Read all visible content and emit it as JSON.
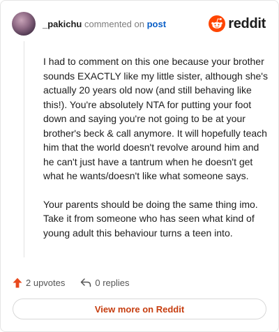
{
  "header": {
    "username": "_pakichu",
    "action_text": "commented on",
    "post_link": "post",
    "brand": "reddit"
  },
  "comment": {
    "paragraphs": [
      "I had to comment on this one because your brother sounds EXACTLY like my little sister, although she's actually 20 years old now (and still behaving like this!). You're absolutely NTA for putting your foot down and saying you're not going to be at your brother's beck & call anymore. It will hopefully teach him that the world doesn't revolve around him and he can't just have a tantrum when he doesn't get what he wants/doesn't like what someone says.",
      "Your parents should be doing the same thing imo. Take it from someone who has seen what kind of young adult this behaviour turns a teen into."
    ]
  },
  "actions": {
    "upvotes": "2 upvotes",
    "replies": "0 replies"
  },
  "footer": {
    "view_more": "View more on Reddit"
  },
  "colors": {
    "brand_orange": "#ff4500",
    "link_blue": "#0a5fc7",
    "upvote_orange": "#e8491d"
  },
  "icons": {
    "logo": "reddit-snoo-icon",
    "upvote": "upvote-arrow-icon",
    "reply": "reply-arrow-icon"
  }
}
